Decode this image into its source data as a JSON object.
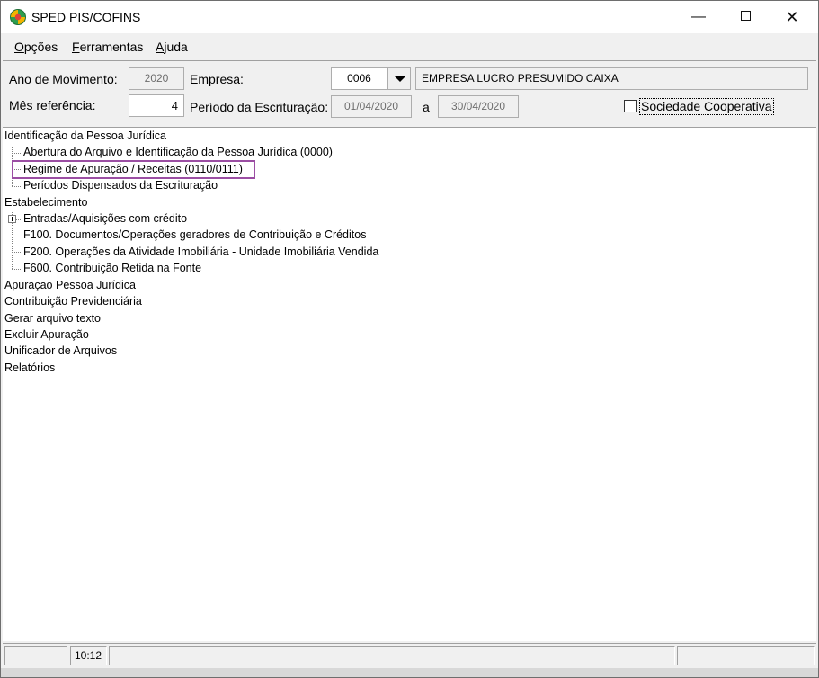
{
  "window": {
    "title": "SPED PIS/COFINS",
    "controls": {
      "minimize": "—",
      "close": "✕"
    }
  },
  "menu": [
    "Opções",
    "Ferramentas",
    "Ajuda"
  ],
  "header": {
    "ano_label": "Ano de Movimento:",
    "ano_value": "2020",
    "empresa_label": "Empresa:",
    "empresa_code": "0006",
    "empresa_name": "EMPRESA LUCRO PRESUMIDO CAIXA",
    "mes_label": "Mês referência:",
    "mes_value": "4",
    "periodo_label": "Período da Escrituração:",
    "periodo_inicio": "01/04/2020",
    "periodo_sep": "a",
    "periodo_fim": "30/04/2020",
    "sociedade_label": "Sociedade Cooperativa",
    "sociedade_checked": false
  },
  "tree": {
    "identificacao": "Identificação da Pessoa Jurídica",
    "abertura": "Abertura do Arquivo e Identificação da Pessoa Jurídica (0000)",
    "regime": "Regime de Apuração / Receitas (0110/0111)",
    "periodos": "Períodos Dispensados da Escrituração",
    "estabelecimento": "Estabelecimento",
    "entradas": "Entradas/Aquisições com crédito",
    "f100": "F100. Documentos/Operações geradores de Contribuição e Créditos",
    "f200": "F200. Operações da Atividade Imobiliária - Unidade Imobiliária Vendida",
    "f600": "F600. Contribuição Retida na Fonte",
    "apuracao": "Apuraçao Pessoa Jurídica",
    "contribuicao": "Contribuição Previdenciária",
    "gerar": "Gerar arquivo texto",
    "excluir": "Excluir Apuração",
    "unificador": "Unificador de Arquivos",
    "relatorios": "Relatórios"
  },
  "status": {
    "time": "10:12"
  },
  "colors": {
    "highlight": "#9b4ea3"
  }
}
